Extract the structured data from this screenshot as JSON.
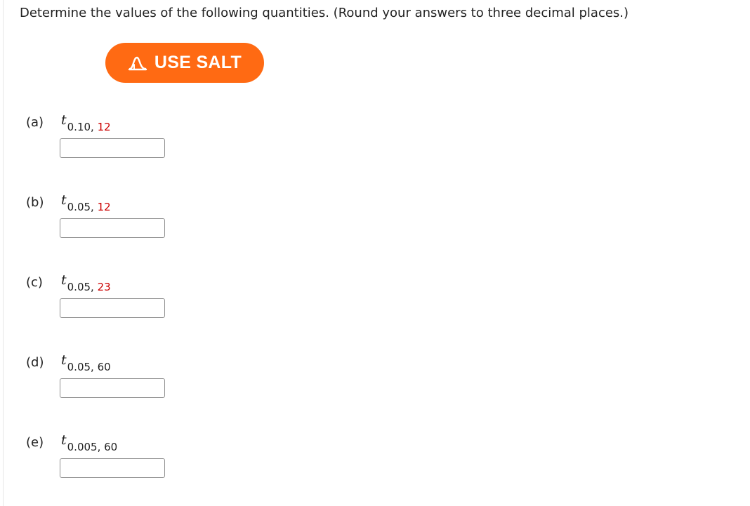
{
  "instructions": "Determine the values of the following quantities. (Round your answers to three decimal places.)",
  "salt_button": {
    "label": "USE SALT",
    "icon": "bell-curve-icon",
    "color": "#ff6a13"
  },
  "colors": {
    "accent": "#ff6a13",
    "highlight_red": "#cc0000"
  },
  "parts": [
    {
      "letter": "(a)",
      "symbol": "t",
      "alpha": "0.10,",
      "df": "12",
      "df_highlighted": true,
      "answer": ""
    },
    {
      "letter": "(b)",
      "symbol": "t",
      "alpha": "0.05,",
      "df": "12",
      "df_highlighted": true,
      "answer": ""
    },
    {
      "letter": "(c)",
      "symbol": "t",
      "alpha": "0.05,",
      "df": "23",
      "df_highlighted": true,
      "answer": ""
    },
    {
      "letter": "(d)",
      "symbol": "t",
      "alpha": "0.05,",
      "df": "60",
      "df_highlighted": false,
      "answer": ""
    },
    {
      "letter": "(e)",
      "symbol": "t",
      "alpha": "0.005,",
      "df": "60",
      "df_highlighted": false,
      "answer": ""
    }
  ]
}
